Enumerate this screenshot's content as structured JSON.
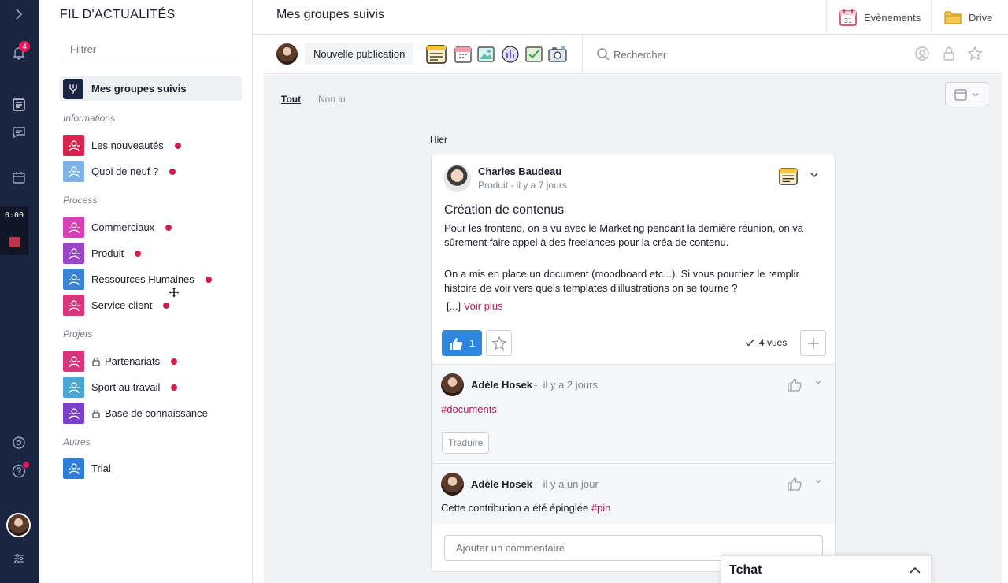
{
  "rail": {
    "notifications_count": "4",
    "timer": "0:00"
  },
  "sidebar": {
    "title": "FIL D'ACTUALITÉS",
    "filter_placeholder": "Filtrer",
    "active_item": "Mes groupes suivis",
    "sections": [
      {
        "label": "Informations",
        "items": [
          {
            "label": "Les nouveautés",
            "color": "#d8234e",
            "locked": false,
            "unread": true
          },
          {
            "label": "Quoi de neuf ?",
            "color": "#7fb3e8",
            "locked": false,
            "unread": true
          }
        ]
      },
      {
        "label": "Process",
        "items": [
          {
            "label": "Commerciaux",
            "color": "#d840b8",
            "locked": false,
            "unread": true
          },
          {
            "label": "Produit",
            "color": "#9b43c9",
            "locked": false,
            "unread": true
          },
          {
            "label": "Ressources Humaines",
            "color": "#3a84d8",
            "locked": false,
            "unread": true
          },
          {
            "label": "Service client",
            "color": "#d8357a",
            "locked": false,
            "unread": true
          }
        ]
      },
      {
        "label": "Projets",
        "items": [
          {
            "label": "Partenariats",
            "color": "#d8357a",
            "locked": true,
            "unread": true
          },
          {
            "label": "Sport au travail",
            "color": "#4aa7d6",
            "locked": false,
            "unread": true
          },
          {
            "label": "Base de connaissance",
            "color": "#7b3fcc",
            "locked": true,
            "unread": false
          }
        ]
      },
      {
        "label": "Autres",
        "items": [
          {
            "label": "Trial",
            "color": "#2e7dd6",
            "locked": false,
            "unread": false
          }
        ]
      }
    ]
  },
  "header": {
    "title": "Mes groupes suivis",
    "events_label": "Évènements",
    "drive_label": "Drive"
  },
  "toolbar": {
    "new_post_label": "Nouvelle publication",
    "search_placeholder": "Rechercher"
  },
  "feed": {
    "tab_all": "Tout",
    "tab_unread": "Non lu",
    "date_label": "Hier",
    "post": {
      "author": "Charles Baudeau",
      "meta": "Produit - il y a 7 jours",
      "title": "Création de contenus",
      "paragraph1": "Pour les frontend, on a vu avec le Marketing pendant la dernière réunion, on va sûrement faire appel à des freelances pour la créa de contenu.",
      "paragraph2": "On a mis en place un document (moodboard etc...). Si vous pourriez le remplir histoire de voir vers quels templates d'illustrations on se tourne ?",
      "ellipsis": "[...]",
      "see_more": "Voir plus",
      "likes": "1",
      "views": "4 vues"
    },
    "comments": [
      {
        "author": "Adèle Hosek",
        "date": "il y a 2 jours",
        "text": "",
        "tag": "#documents",
        "translate": "Traduire"
      },
      {
        "author": "Adèle Hosek",
        "date": "il y a un jour",
        "text": "Cette contribution a été épinglée ",
        "tag": "#pin"
      }
    ],
    "comment_placeholder": "Ajouter un commentaire"
  },
  "chat": {
    "label": "Tchat"
  }
}
